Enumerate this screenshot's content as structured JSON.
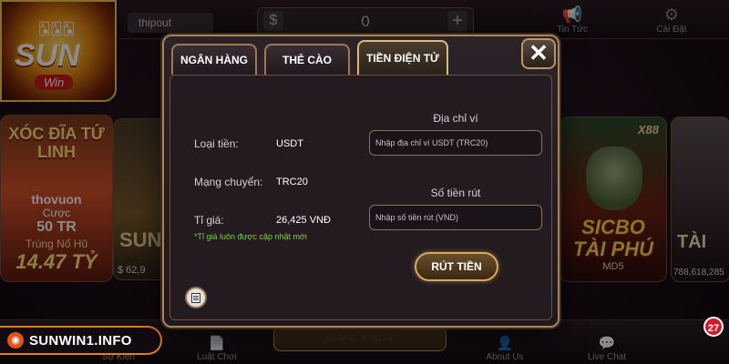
{
  "top": {
    "username": "thipout",
    "balance_symbol": "$",
    "balance": "0",
    "plus": "+",
    "news_label": "Tin Tức",
    "settings_label": "Cài Đặt"
  },
  "logo": {
    "text": "SUN",
    "sub": "Win"
  },
  "games": {
    "xocdia": {
      "title": "XÓC ĐĨA TỨ LINH",
      "winner_name": "thovuon",
      "won_label": "Cược",
      "bet": "50 TR",
      "jackpot_label": "Trúng Nổ Hũ",
      "jackpot": "14.47 TỶ"
    },
    "sun_card": {
      "title": "SUN",
      "amount": "$ 62,9"
    },
    "sicbo": {
      "badge": "X88",
      "line1": "SICBO",
      "line2": "TÀI PHÚ",
      "line3": "MD5"
    },
    "tai_card": {
      "title": "TÀI",
      "amount": "788,618,285"
    }
  },
  "bottom": {
    "items": [
      "Sự Kiện",
      "Luật Chơi",
      "About Us",
      "Live Chat"
    ],
    "center_button": "RÚT TIỀN"
  },
  "site_badge": "SUNWIN1.INFO",
  "notification_count": "27",
  "modal": {
    "tabs": [
      "NGÂN HÀNG",
      "THẺ CÀO",
      "TIỀN ĐIỆN TỬ"
    ],
    "active_tab": "TIỀN ĐIỆN TỬ",
    "close": "✕",
    "currency_label": "Loại tiền:",
    "currency_value": "USDT",
    "network_label": "Mạng chuyển:",
    "network_value": "TRC20",
    "rate_label": "Tỉ giá:",
    "rate_value": "26,425 VNĐ",
    "rate_note": "*Tỉ giá luôn được cập nhật mới",
    "wallet_title": "Địa chỉ ví",
    "wallet_placeholder": "Nhập địa chỉ ví USDT (TRC20)",
    "amount_title": "Số tiền rút",
    "amount_placeholder": "Nhập số tiền rút (VND)",
    "submit": "RÚT TIỀN"
  }
}
